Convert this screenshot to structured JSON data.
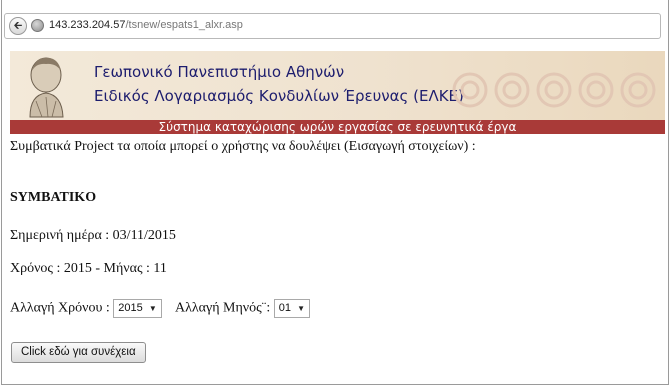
{
  "browser": {
    "url_host": "143.233.204.57",
    "url_path": "/tsnew/espats1_alxr.asp"
  },
  "banner": {
    "title_line1": "Γεωπονικό Πανεπιστήμιο Αθηνών",
    "title_line2": "Ειδικός Λογαριασμός Κονδυλίων Έρευνας (ΕΛΚΕ)",
    "subtitle": "Σύστημα καταχώρισης ωρών εργασίας σε ερευνητικά έργα"
  },
  "content": {
    "intro": "Συμβατικά Project τα οποία μπορεί ο χρήστης να δουλέψει (Εισαγωγή στοιχείων) :",
    "section_title": "SYMBATIKO",
    "today": "Σημερινή ημέρα : 03/11/2015",
    "year_month": "Χρόνος : 2015 - Μήνας : 11",
    "change_year_label": "Αλλαγή Χρόνου :",
    "year_value": "2015",
    "change_month_label": "Αλλαγή Μηνός¨:",
    "month_value": "01",
    "continue_button": "Click εδώ για συνέχεια"
  },
  "icons": {
    "back": "back-arrow-icon",
    "site": "globe-icon"
  }
}
